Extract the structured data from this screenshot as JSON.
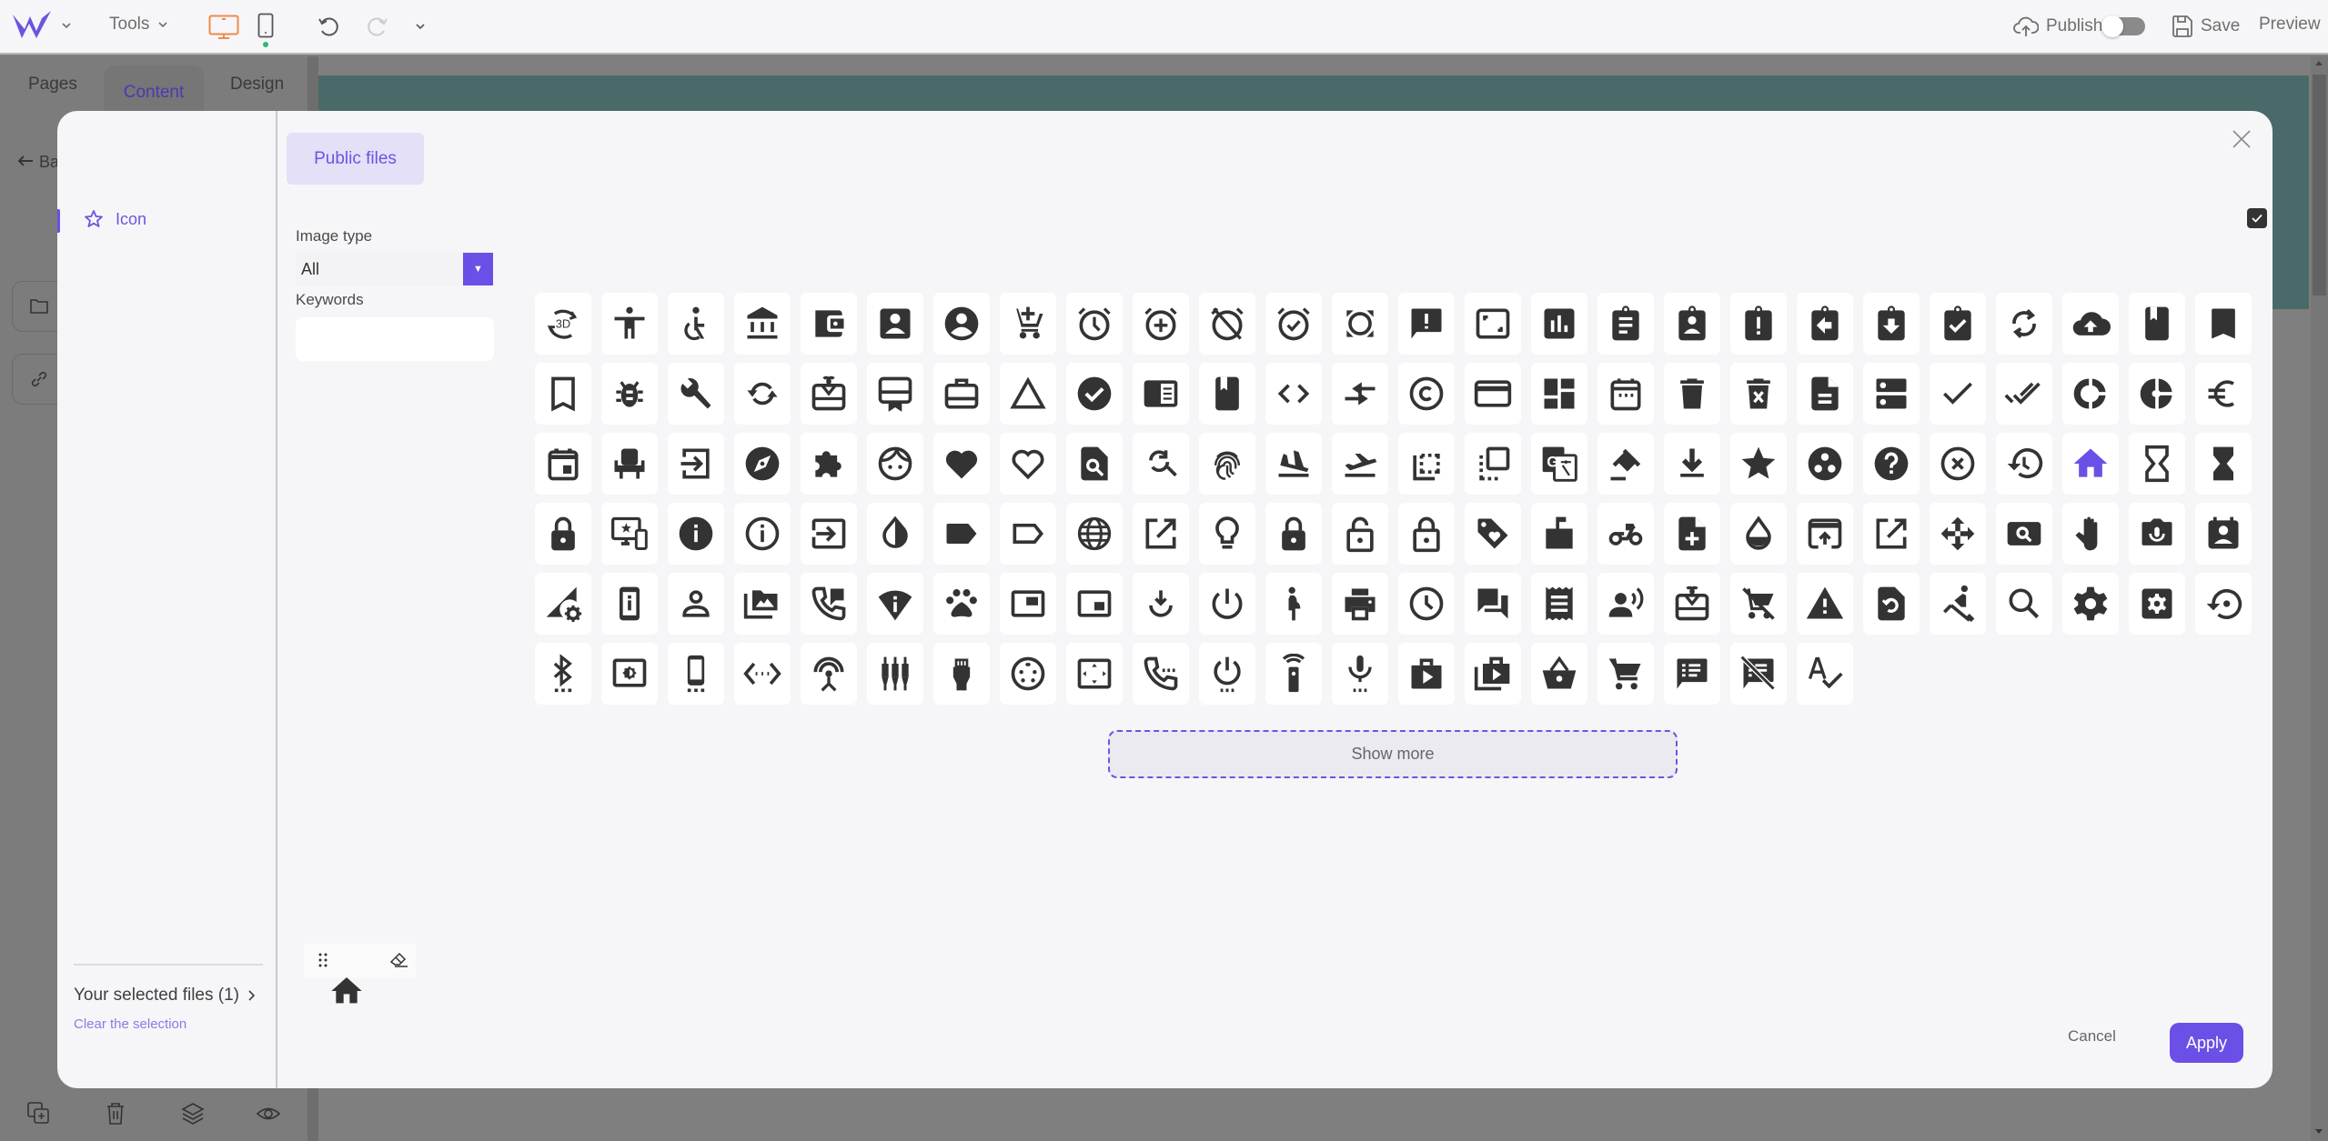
{
  "topbar": {
    "logo": "W",
    "tools_label": "Tools",
    "publish_label": "Publish",
    "publish_toggle_on": false,
    "save_label": "Save",
    "preview_label": "Preview",
    "device_active": "desktop",
    "accent_color": "#6b4fe6",
    "desktop_color": "#f08a4b"
  },
  "left_panel": {
    "tabs": [
      {
        "label": "Pages",
        "active": false
      },
      {
        "label": "Content",
        "active": true
      },
      {
        "label": "Design",
        "active": false
      }
    ],
    "back_label": "Ba"
  },
  "modal": {
    "sidebar": {
      "items": [
        {
          "label": "Icon",
          "icon": "star-outline-icon",
          "selected": true
        }
      ],
      "selected_files_label": "Your selected files (1)",
      "clear_selection_label": "Clear the selection"
    },
    "tab_label": "Public files",
    "filters": {
      "image_type_label": "Image type",
      "image_type_value": "All",
      "keywords_label": "Keywords",
      "keywords_value": "",
      "keywords_placeholder": ""
    },
    "select_all_checked": true,
    "icons": [
      "3d-rotation",
      "accessibility",
      "accessible",
      "account-balance",
      "account-balance-wallet",
      "account-box",
      "account-circle",
      "add-shopping-cart",
      "alarm",
      "alarm-add",
      "alarm-off",
      "alarm-on",
      "all-out",
      "announcement",
      "aspect-ratio",
      "assessment",
      "assignment",
      "assignment-ind",
      "assignment-late",
      "assignment-return",
      "assignment-returned",
      "assignment-turned-in",
      "autorenew",
      "backup",
      "book",
      "bookmark",
      "bookmark-border",
      "bug-report",
      "build",
      "cached",
      "card-giftcard",
      "card-membership",
      "card-travel",
      "change-history",
      "check-circle",
      "chrome-reader-mode",
      "class",
      "code",
      "compare-arrows",
      "copyright",
      "credit-card",
      "dashboard",
      "date-range",
      "delete",
      "delete-forever",
      "description",
      "dns",
      "done",
      "done-all",
      "donut-large",
      "donut-small",
      "euro-symbol",
      "event",
      "event-seat",
      "exit-to-app",
      "explore",
      "extension",
      "face",
      "favorite",
      "favorite-border",
      "find-in-page",
      "find-replace",
      "fingerprint",
      "flight-land",
      "flight-takeoff",
      "flip-to-back",
      "flip-to-front",
      "g-translate",
      "gavel",
      "get-app",
      "grade",
      "group-work",
      "help",
      "highlight-off",
      "history",
      "home",
      "hourglass-empty",
      "hourglass-full",
      "https",
      "important-devices",
      "info",
      "info-outline",
      "input",
      "invert-colors",
      "label",
      "label-outline",
      "language",
      "launch",
      "lightbulb-outline",
      "lock",
      "lock-open",
      "lock-outline",
      "loyalty",
      "markunread-mailbox",
      "motorcycle",
      "note-add",
      "opacity",
      "open-in-browser",
      "open-in-new",
      "open-with",
      "pageview",
      "pan-tool",
      "perm-camera-mic",
      "perm-contact-calendar",
      "perm-data-setting",
      "perm-device-information",
      "perm-identity",
      "perm-media",
      "perm-phone-msg",
      "perm-scan-wifi",
      "pets",
      "picture-in-picture",
      "picture-in-picture-alt",
      "play-for-work",
      "power-settings-new",
      "pregnant-woman",
      "print",
      "query-builder",
      "question-answer",
      "receipt",
      "record-voice-over",
      "redeem",
      "remove-shopping-cart",
      "report-problem",
      "restore-page",
      "rowing",
      "search",
      "settings",
      "settings-applications",
      "settings-backup-restore",
      "settings-bluetooth",
      "settings-brightness",
      "settings-cell",
      "settings-ethernet",
      "settings-input-antenna",
      "settings-input-component",
      "settings-input-hdmi",
      "settings-input-svideo",
      "settings-overscan",
      "settings-phone",
      "settings-power",
      "settings-remote",
      "settings-voice",
      "shop",
      "shop-two",
      "shopping-basket",
      "shopping-cart",
      "speaker-notes",
      "speaker-notes-off",
      "spellcheck"
    ],
    "selected_icon": "home",
    "show_more_label": "Show more",
    "preview": {
      "icon": "home"
    },
    "cancel_label": "Cancel",
    "apply_label": "Apply"
  }
}
